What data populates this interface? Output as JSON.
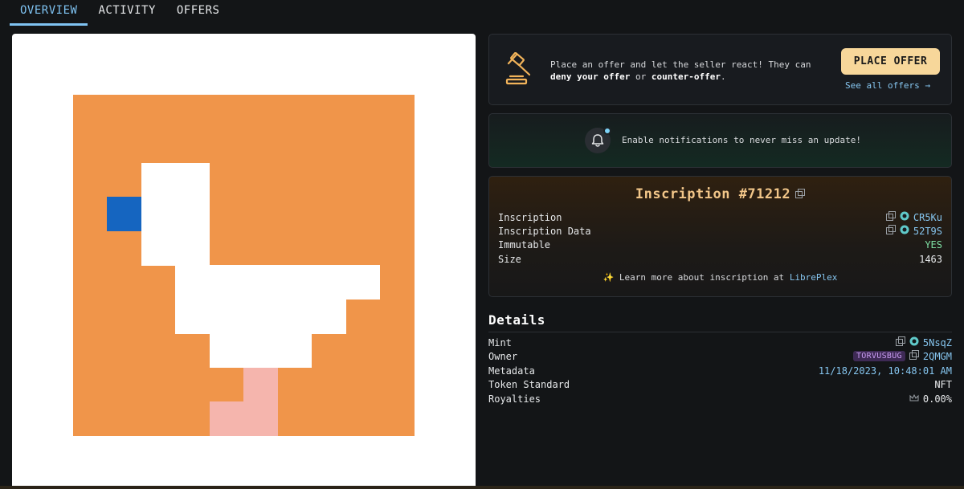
{
  "tabs": [
    {
      "label": "OVERVIEW",
      "active": true
    },
    {
      "label": "ACTIVITY",
      "active": false
    },
    {
      "label": "OFFERS",
      "active": false
    }
  ],
  "artwork": {
    "palette": {
      "background": "#f0954a",
      "body": "#ffffff",
      "beak": "#1565c0",
      "leg": "#f5b5ad",
      "frame": "#ffffff"
    }
  },
  "offer": {
    "line1": "Place an offer and let the seller react! They can",
    "deny": "deny your offer",
    "or": " or ",
    "counter": "counter-offer",
    "period": ".",
    "button_label": "PLACE OFFER",
    "see_all": "See all offers →"
  },
  "notification": {
    "text": "Enable notifications to never miss an update!"
  },
  "inscription": {
    "title": "Inscription #71212",
    "rows": [
      {
        "label": "Inscription",
        "value": "CR5Ku"
      },
      {
        "label": "Inscription Data",
        "value": "52T9S"
      },
      {
        "label": "Immutable",
        "value": "YES"
      },
      {
        "label": "Size",
        "value": "1463"
      }
    ],
    "learn_prefix": "✨ Learn more about inscription at ",
    "learn_link": "LibrePlex"
  },
  "details": {
    "title": "Details",
    "rows": [
      {
        "label": "Mint",
        "value": "5NsqZ"
      },
      {
        "label": "Owner",
        "badge": "TORVUSBUG",
        "value": "2QMGM"
      },
      {
        "label": "Metadata",
        "value": "11/18/2023, 10:48:01 AM"
      },
      {
        "label": "Token Standard",
        "value": "NFT"
      },
      {
        "label": "Royalties",
        "value": "0.00%"
      }
    ]
  },
  "colors": {
    "accent": "#7fc3f2",
    "button": "#f7d79a",
    "gold": "#f2c689",
    "green": "#7fe0a4",
    "badge": "#c99cf2"
  }
}
